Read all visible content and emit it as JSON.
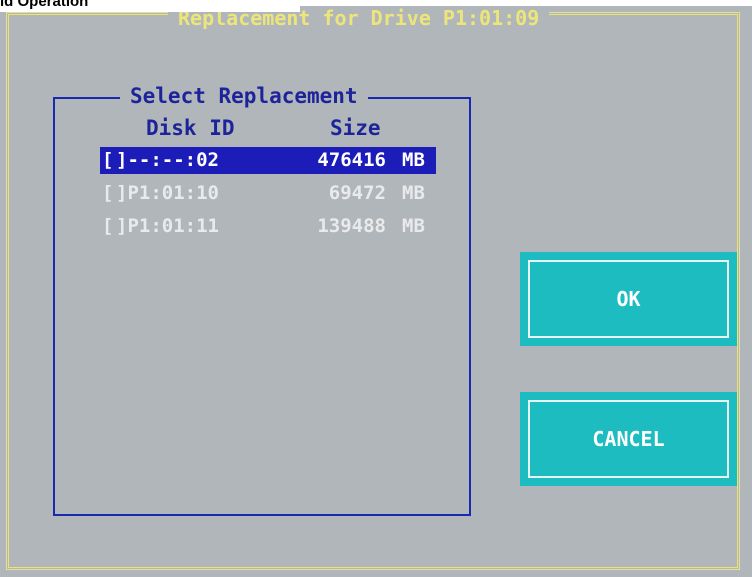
{
  "window": {
    "caption": "ld Operation"
  },
  "dialog": {
    "title": "Replacement for Drive P1:01:09",
    "group_title": "Select Replacement",
    "columns": {
      "disk_id": "Disk ID",
      "size": "Size"
    },
    "rows": [
      {
        "check": "[",
        "id": "]--:--:02",
        "size": "476416",
        "unit": "MB",
        "selected": true
      },
      {
        "check": "[",
        "id": "]P1:01:10",
        "size": "69472",
        "unit": "MB",
        "selected": false
      },
      {
        "check": "[",
        "id": "]P1:01:11",
        "size": "139488",
        "unit": "MB",
        "selected": false
      }
    ],
    "buttons": {
      "ok": "OK",
      "cancel": "CANCEL"
    }
  },
  "colors": {
    "background": "#b1b6ba",
    "frame": "#e9e47e",
    "group_border": "#1a2ab0",
    "selection": "#1c1cb8",
    "button": "#1cbcc0"
  }
}
